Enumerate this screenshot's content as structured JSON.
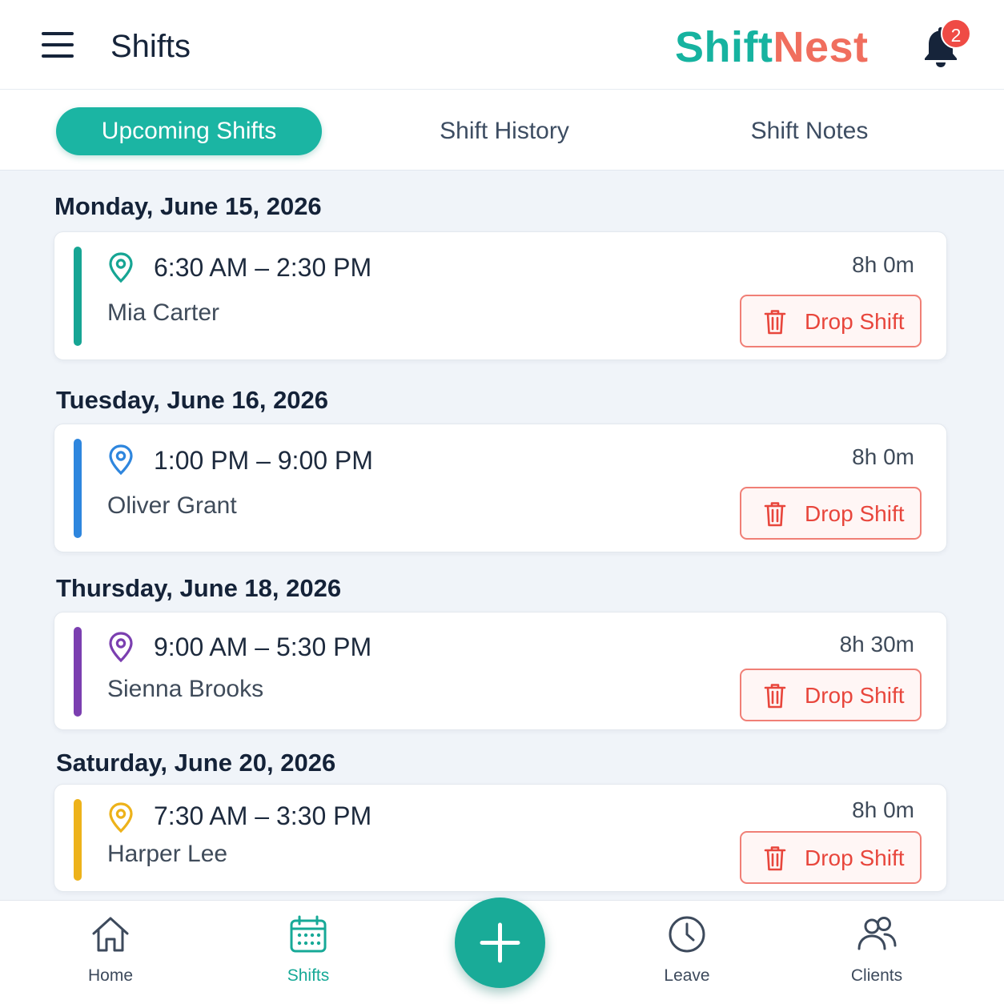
{
  "header": {
    "title": "Shifts",
    "brand_part1": "Shift",
    "brand_part2": "Nest",
    "notification_count": "2",
    "menu_icon": "hamburger-menu-icon",
    "bell_icon": "bell-icon"
  },
  "tabs": [
    {
      "label": "Upcoming Shifts",
      "active": true
    },
    {
      "label": "Shift History",
      "active": false
    },
    {
      "label": "Shift Notes",
      "active": false
    }
  ],
  "days": [
    {
      "date": "Monday, June 15, 2026",
      "time": "6:30 AM – 2:30 PM",
      "client": "Mia Carter",
      "duration": "8h 0m",
      "action": "Drop Shift",
      "color": "#16a594"
    },
    {
      "date": "Tuesday, June 16, 2026",
      "time": "1:00 PM – 9:00 PM",
      "client": "Oliver Grant",
      "duration": "8h 0m",
      "action": "Drop Shift",
      "color": "#2e86de"
    },
    {
      "date": "Thursday, June 18, 2026",
      "time": "9:00 AM – 5:30 PM",
      "client": "Sienna Brooks",
      "duration": "8h 30m",
      "action": "Drop Shift",
      "color": "#7b3fb0"
    },
    {
      "date": "Saturday, June 20, 2026",
      "time": "7:30 AM – 3:30 PM",
      "client": "Harper Lee",
      "duration": "8h 0m",
      "action": "Drop Shift",
      "color": "#edb21a"
    }
  ],
  "nav": {
    "home": "Home",
    "shifts": "Shifts",
    "leave": "Leave",
    "clients": "Clients",
    "active": "Shifts",
    "fab_icon": "plus-icon"
  },
  "colors": {
    "accent_teal": "#1bb5a3",
    "brand_coral": "#f06e5e",
    "danger": "#e8463c",
    "badge": "#ef4b45"
  }
}
